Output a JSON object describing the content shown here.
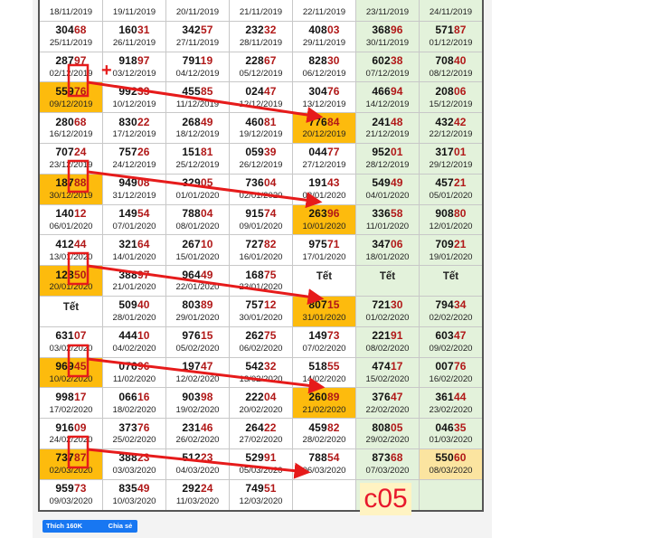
{
  "rows": [
    [
      [
        "18/11/2019",
        "19/11/2019",
        "20/11/2019",
        "21/11/2019",
        "22/11/2019",
        "23/11/2019",
        "24/11/2019"
      ]
    ],
    [
      {
        "n": "30468",
        "d": "25/11/2019"
      },
      {
        "n": "16031",
        "d": "26/11/2019"
      },
      {
        "n": "34257",
        "d": "27/11/2019"
      },
      {
        "n": "23232",
        "d": "28/11/2019"
      },
      {
        "n": "40803",
        "d": "29/11/2019"
      },
      {
        "n": "36896",
        "d": "30/11/2019"
      },
      {
        "n": "57187",
        "d": "01/12/2019"
      }
    ],
    [
      {
        "n": "28797",
        "d": "02/12/2019"
      },
      {
        "n": "91897",
        "d": "03/12/2019"
      },
      {
        "n": "79119",
        "d": "04/12/2019"
      },
      {
        "n": "22867",
        "d": "05/12/2019"
      },
      {
        "n": "82830",
        "d": "06/12/2019"
      },
      {
        "n": "60238",
        "d": "07/12/2019"
      },
      {
        "n": "70840",
        "d": "08/12/2019"
      }
    ],
    [
      {
        "n": "55976",
        "d": "09/12/2019",
        "hl": true
      },
      {
        "n": "99233",
        "d": "10/12/2019"
      },
      {
        "n": "45585",
        "d": "11/12/2019"
      },
      {
        "n": "02447",
        "d": "12/12/2019"
      },
      {
        "n": "30476",
        "d": "13/12/2019"
      },
      {
        "n": "46694",
        "d": "14/12/2019"
      },
      {
        "n": "20806",
        "d": "15/12/2019"
      }
    ],
    [
      {
        "n": "28068",
        "d": "16/12/2019"
      },
      {
        "n": "83022",
        "d": "17/12/2019"
      },
      {
        "n": "26849",
        "d": "18/12/2019"
      },
      {
        "n": "46081",
        "d": "19/12/2019"
      },
      {
        "n": "77684",
        "d": "20/12/2019",
        "hl": true
      },
      {
        "n": "24148",
        "d": "21/12/2019"
      },
      {
        "n": "43242",
        "d": "22/12/2019"
      }
    ],
    [
      {
        "n": "70724",
        "d": "23/12/2019"
      },
      {
        "n": "75726",
        "d": "24/12/2019"
      },
      {
        "n": "15181",
        "d": "25/12/2019"
      },
      {
        "n": "05939",
        "d": "26/12/2019"
      },
      {
        "n": "04477",
        "d": "27/12/2019"
      },
      {
        "n": "95201",
        "d": "28/12/2019"
      },
      {
        "n": "31701",
        "d": "29/12/2019"
      }
    ],
    [
      {
        "n": "18788",
        "d": "30/12/2019",
        "hl": true
      },
      {
        "n": "94908",
        "d": "31/12/2019"
      },
      {
        "n": "32905",
        "d": "01/01/2020"
      },
      {
        "n": "73604",
        "d": "02/01/2020"
      },
      {
        "n": "19143",
        "d": "03/01/2020"
      },
      {
        "n": "54949",
        "d": "04/01/2020"
      },
      {
        "n": "45721",
        "d": "05/01/2020"
      }
    ],
    [
      {
        "n": "14012",
        "d": "06/01/2020"
      },
      {
        "n": "14954",
        "d": "07/01/2020"
      },
      {
        "n": "78804",
        "d": "08/01/2020"
      },
      {
        "n": "91574",
        "d": "09/01/2020"
      },
      {
        "n": "26396",
        "d": "10/01/2020",
        "hl": true
      },
      {
        "n": "33658",
        "d": "11/01/2020"
      },
      {
        "n": "90880",
        "d": "12/01/2020"
      }
    ],
    [
      {
        "n": "41244",
        "d": "13/01/2020"
      },
      {
        "n": "32164",
        "d": "14/01/2020"
      },
      {
        "n": "26710",
        "d": "15/01/2020"
      },
      {
        "n": "72782",
        "d": "16/01/2020"
      },
      {
        "n": "97571",
        "d": "17/01/2020"
      },
      {
        "n": "34706",
        "d": "18/01/2020"
      },
      {
        "n": "70921",
        "d": "19/01/2020"
      }
    ],
    [
      {
        "n": "12850",
        "d": "20/01/2020",
        "hl": true
      },
      {
        "n": "38897",
        "d": "21/01/2020"
      },
      {
        "n": "96449",
        "d": "22/01/2020"
      },
      {
        "n": "16875",
        "d": "23/01/2020"
      },
      {
        "t": "Tết"
      },
      {
        "t": "Tết"
      },
      {
        "t": "Tết"
      }
    ],
    [
      {
        "t": "Tết"
      },
      {
        "n": "50940",
        "d": "28/01/2020"
      },
      {
        "n": "80389",
        "d": "29/01/2020"
      },
      {
        "n": "75712",
        "d": "30/01/2020"
      },
      {
        "n": "80715",
        "d": "31/01/2020",
        "hl": true
      },
      {
        "n": "72130",
        "d": "01/02/2020"
      },
      {
        "n": "79434",
        "d": "02/02/2020"
      }
    ],
    [
      {
        "n": "63107",
        "d": "03/02/2020"
      },
      {
        "n": "44410",
        "d": "04/02/2020"
      },
      {
        "n": "97615",
        "d": "05/02/2020"
      },
      {
        "n": "26275",
        "d": "06/02/2020"
      },
      {
        "n": "14973",
        "d": "07/02/2020"
      },
      {
        "n": "22191",
        "d": "08/02/2020"
      },
      {
        "n": "60347",
        "d": "09/02/2020"
      }
    ],
    [
      {
        "n": "96945",
        "d": "10/02/2020",
        "hl": true
      },
      {
        "n": "07696",
        "d": "11/02/2020"
      },
      {
        "n": "19747",
        "d": "12/02/2020"
      },
      {
        "n": "54232",
        "d": "13/02/2020"
      },
      {
        "n": "51855",
        "d": "14/02/2020"
      },
      {
        "n": "47417",
        "d": "15/02/2020"
      },
      {
        "n": "00776",
        "d": "16/02/2020"
      }
    ],
    [
      {
        "n": "99817",
        "d": "17/02/2020"
      },
      {
        "n": "06616",
        "d": "18/02/2020"
      },
      {
        "n": "90398",
        "d": "19/02/2020"
      },
      {
        "n": "22204",
        "d": "20/02/2020"
      },
      {
        "n": "26089",
        "d": "21/02/2020",
        "hl": true
      },
      {
        "n": "37647",
        "d": "22/02/2020"
      },
      {
        "n": "36144",
        "d": "23/02/2020"
      }
    ],
    [
      {
        "n": "91609",
        "d": "24/02/2020"
      },
      {
        "n": "37376",
        "d": "25/02/2020"
      },
      {
        "n": "23146",
        "d": "26/02/2020"
      },
      {
        "n": "26422",
        "d": "27/02/2020"
      },
      {
        "n": "45982",
        "d": "28/02/2020"
      },
      {
        "n": "80805",
        "d": "29/02/2020"
      },
      {
        "n": "04635",
        "d": "01/03/2020"
      }
    ],
    [
      {
        "n": "73787",
        "d": "02/03/2020",
        "hl": true
      },
      {
        "n": "38823",
        "d": "03/03/2020"
      },
      {
        "n": "51223",
        "d": "04/03/2020"
      },
      {
        "n": "52991",
        "d": "05/03/2020"
      },
      {
        "n": "78854",
        "d": "06/03/2020"
      },
      {
        "n": "87368",
        "d": "07/03/2020"
      },
      {
        "n": "55060",
        "d": "08/03/2020",
        "hlw": true
      }
    ],
    [
      {
        "n": "95973",
        "d": "09/03/2020"
      },
      {
        "n": "83549",
        "d": "10/03/2020"
      },
      {
        "n": "29224",
        "d": "11/03/2020"
      },
      {
        "n": "74951",
        "d": "12/03/2020"
      },
      {
        "e": true
      },
      {
        "e": true
      },
      {
        "e": true
      }
    ]
  ],
  "annotation": {
    "label": "c05",
    "color": "#e8182c",
    "plus": "+"
  },
  "colors": {
    "highlight": "#fdbb0d",
    "weekend": "#e3f2db",
    "tail": "#b11818"
  },
  "buttons": {
    "like": "Thích 160K",
    "share": "Chia sẻ"
  }
}
